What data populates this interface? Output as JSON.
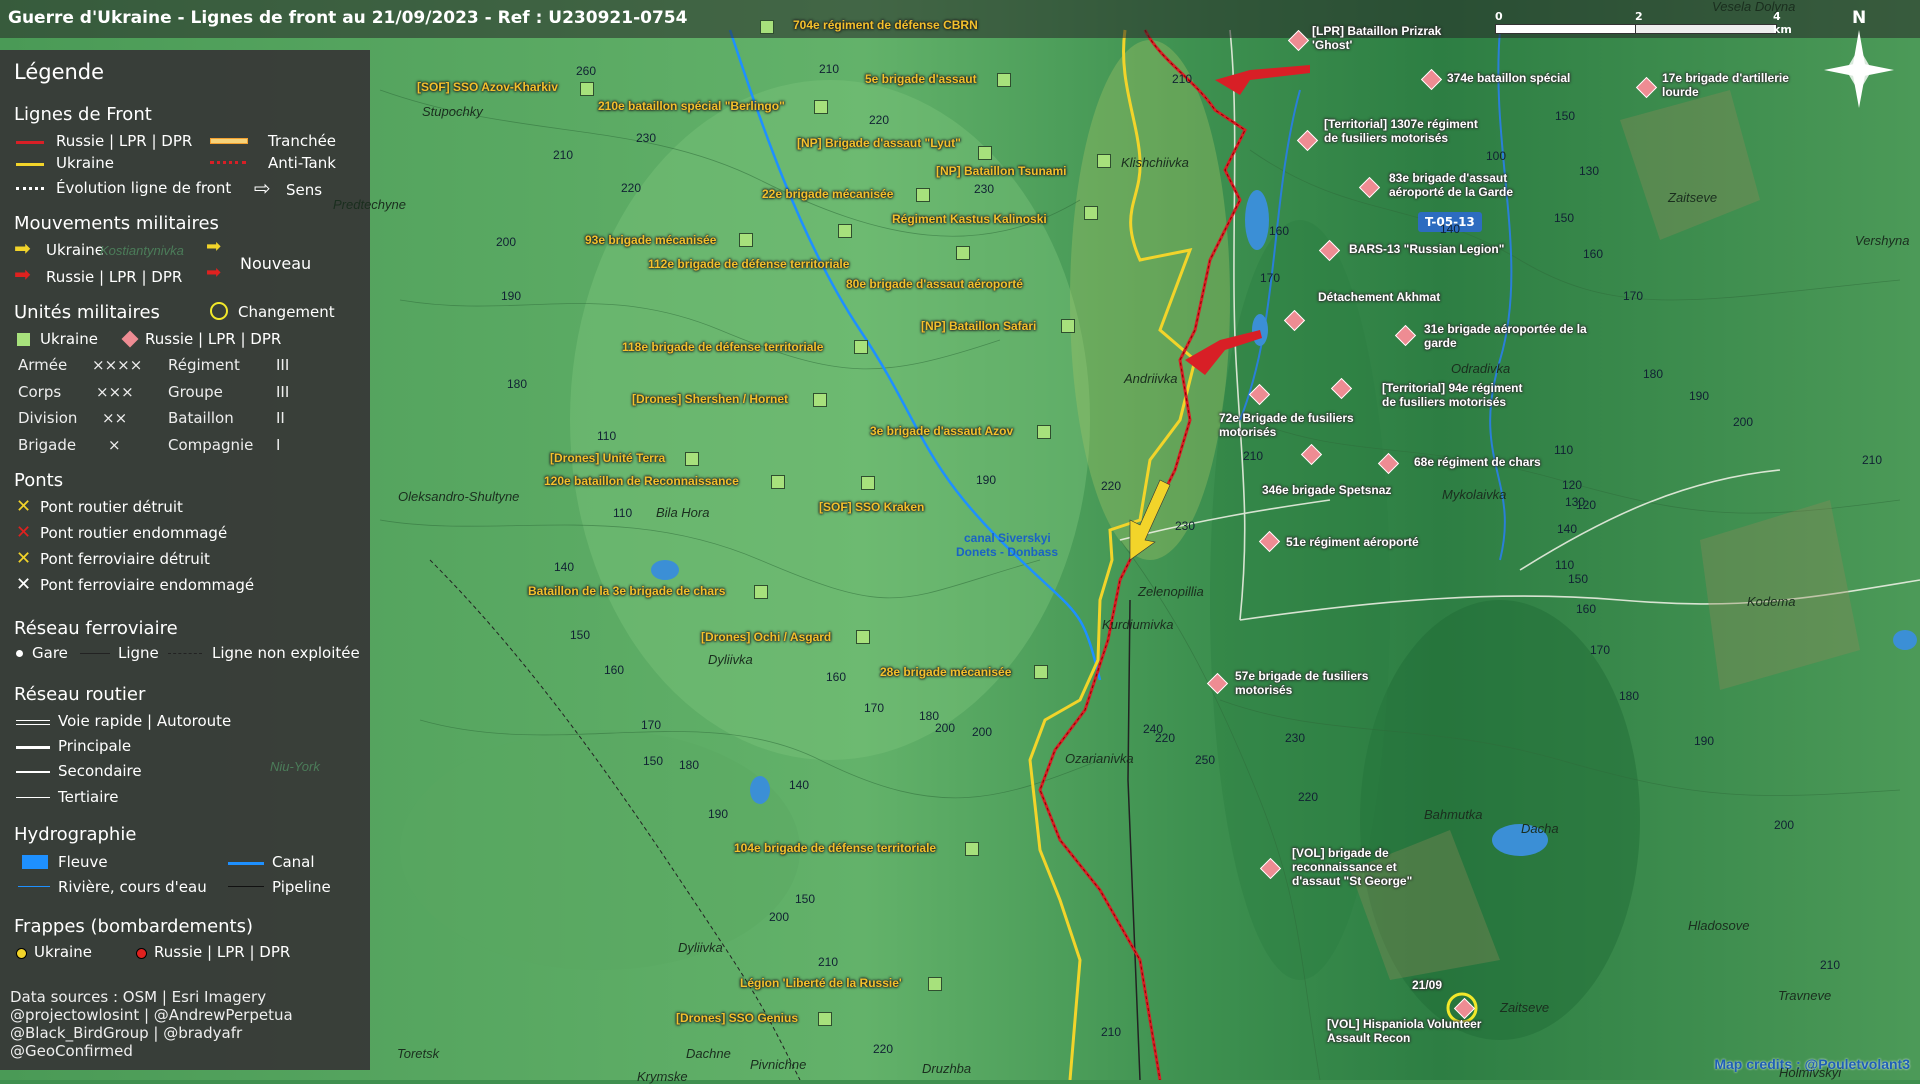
{
  "header": {
    "title": "Guerre d'Ukraine - Lignes de front au 21/09/2023 - Ref : U230921-0754"
  },
  "legend": {
    "title": "Légende",
    "front_lines": {
      "heading": "Lignes de Front",
      "russia": "Russie | LPR | DPR",
      "ukraine": "Ukraine",
      "evolution": "Évolution ligne de front",
      "trench": "Tranchée",
      "antitank": "Anti-Tank",
      "direction": "Sens"
    },
    "movements": {
      "heading": "Mouvements militaires",
      "ukraine": "Ukraine",
      "russia": "Russie | LPR | DPR",
      "new": "Nouveau"
    },
    "units": {
      "heading": "Unités militaires",
      "change": "Changement",
      "ukraine": "Ukraine",
      "russia": "Russie | LPR | DPR",
      "rows": [
        {
          "a": "Armée",
          "as": "××××",
          "b": "Régiment",
          "bs": "III"
        },
        {
          "a": "Corps",
          "as": "×××",
          "b": "Groupe",
          "bs": "III"
        },
        {
          "a": "Division",
          "as": "××",
          "b": "Bataillon",
          "bs": "II"
        },
        {
          "a": "Brigade",
          "as": "×",
          "b": "Compagnie",
          "bs": "I"
        }
      ]
    },
    "bridges": {
      "heading": "Ponts",
      "items": [
        "Pont routier détruit",
        "Pont routier endommagé",
        "Pont ferroviaire détruit",
        "Pont ferroviaire endommagé"
      ]
    },
    "rail": {
      "heading": "Réseau ferroviaire",
      "station": "Gare",
      "line": "Ligne",
      "unused": "Ligne non exploitée"
    },
    "road": {
      "heading": "Réseau routier",
      "items": [
        "Voie rapide | Autoroute",
        "Principale",
        "Secondaire",
        "Tertiaire"
      ]
    },
    "hydro": {
      "heading": "Hydrographie",
      "river_big": "Fleuve",
      "canal": "Canal",
      "stream": "Rivière, cours d'eau",
      "pipeline": "Pipeline"
    },
    "strikes": {
      "heading": "Frappes (bombardements)",
      "ukraine": "Ukraine",
      "russia": "Russie | LPR | DPR"
    },
    "sources": [
      "Data sources : OSM | Esri Imagery",
      "@projectowlosint | @AndrewPerpetua",
      "@Black_BirdGroup | @bradyafr",
      "@GeoConfirmed"
    ]
  },
  "colors": {
    "russia": "#e0211f",
    "ukraine": "#f2d42a",
    "ukr_unit": "#a7e17c",
    "rus_unit": "#ee8c93",
    "canal": "#1e90ff"
  },
  "scale": {
    "labels": [
      "0",
      "2",
      "4 km"
    ]
  },
  "compass": {
    "label": "N"
  },
  "road_badge": "T-05-13",
  "date_label": "21/09",
  "credits": "Map credits : @Pouletvolant3",
  "ukraine_units": [
    "704e régiment de défense CBRN",
    "[SOF] SSO Azov-Kharkiv",
    "5e brigade d'assaut",
    "210e bataillon spécial \"Berlingo\"",
    "[NP] Brigade d'assaut \"Lyut\"",
    "[NP] Bataillon Tsunami",
    "22e brigade mécanisée",
    "Régiment Kastus Kalinoski",
    "93e brigade mécanisée",
    "112e brigade de défense territoriale",
    "80e brigade d'assaut aéroporté",
    "[NP] Bataillon Safari",
    "118e brigade de défense territoriale",
    "[Drones] Shershen / Hornet",
    "3e brigade d'assaut Azov",
    "[Drones] Unité Terra",
    "120e bataillon de Reconnaissance",
    "[SOF] SSO Kraken",
    "Bataillon de la 3e brigade de chars",
    "[Drones] Ochi / Asgard",
    "28e brigade mécanisée",
    "104e brigade de défense territoriale",
    "Légion 'Liberté de la Russie'",
    "[Drones] SSO Genius"
  ],
  "russia_units": [
    "[LPR] Bataillon Prizrak 'Ghost'",
    "374e bataillon spécial",
    "17e brigade d'artillerie lourde",
    "[Territorial] 1307e régiment de fusiliers motorisés",
    "83e brigade d'assaut aéroporté de la Garde",
    "BARS-13 \"Russian Legion\"",
    "Détachement Akhmat",
    "31e brigade aéroportée de la garde",
    "[Territorial] 94e régiment de fusiliers motorisés",
    "72e Brigade de fusiliers motorisés",
    "68e régiment de chars",
    "346e brigade Spetsnaz",
    "51e régiment aéroporté",
    "57e brigade de fusiliers motorisés",
    "[VOL] brigade de reconnaissance et d'assaut \"St George\"",
    "[VOL] Hispaniola Volunteer Assault Recon"
  ],
  "places": [
    "Vesela Dolyna",
    "Stupochky",
    "Klishchiivka",
    "Zaitseve",
    "Vershyna",
    "Predtechyne",
    "Kostiantynivka",
    "Andriivka",
    "Odradivka",
    "Oleksandro-Shultyne",
    "Bila Hora",
    "Mykolaivka",
    "Zelenopillia",
    "Kurdiumivka",
    "Kodema",
    "Dyliivka",
    "Ozarianivka",
    "Bahmutka",
    "Dacha",
    "Hladosove",
    "Zaitseve",
    "Travneve",
    "Holmivskyi",
    "Toretsk",
    "Dachne",
    "Pivnichne",
    "Druzhba",
    "Krymske",
    "Niu-York",
    "Dyliivka"
  ],
  "canal_label": [
    "canal Siverskyi",
    "Donets - Donbass"
  ],
  "elevations": [
    "260",
    "210",
    "220",
    "230",
    "210",
    "220",
    "230",
    "210",
    "200",
    "190",
    "180",
    "110",
    "140",
    "150",
    "160",
    "170",
    "180",
    "190",
    "200",
    "210",
    "220",
    "110",
    "160",
    "170",
    "150",
    "100",
    "150",
    "160",
    "170",
    "180",
    "190",
    "200",
    "210",
    "110",
    "120",
    "130",
    "140",
    "150",
    "160",
    "170",
    "180",
    "190",
    "200",
    "210",
    "220",
    "230",
    "240",
    "250",
    "230",
    "220",
    "210",
    "200",
    "190",
    "180",
    "170",
    "160",
    "150",
    "140",
    "130",
    "120",
    "110",
    "140",
    "150",
    "200",
    "210",
    "220"
  ]
}
